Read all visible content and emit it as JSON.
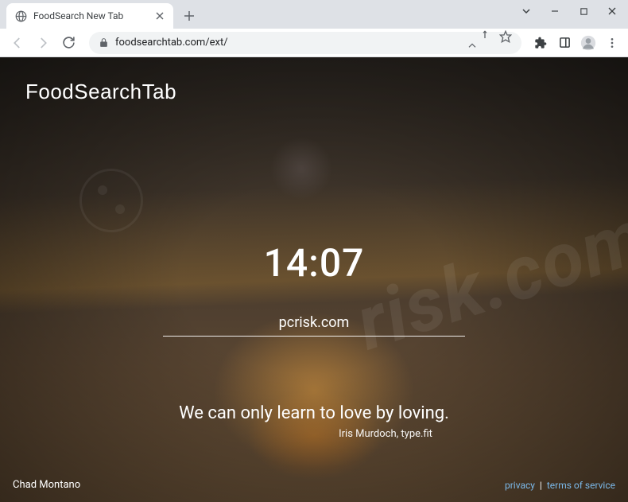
{
  "browser": {
    "tab_title": "FoodSearch New Tab",
    "url": "foodsearchtab.com/ext/"
  },
  "page": {
    "brand": "FoodSearchTab",
    "clock": "14:07",
    "search_value": "pcrisk.com",
    "quote": {
      "text": "We can only learn to love by loving.",
      "author": "Iris Murdoch, type.fit"
    },
    "photo_credit": "Chad Montano",
    "footer": {
      "privacy": "privacy",
      "terms": "terms of service"
    }
  },
  "watermark": "risk.com"
}
